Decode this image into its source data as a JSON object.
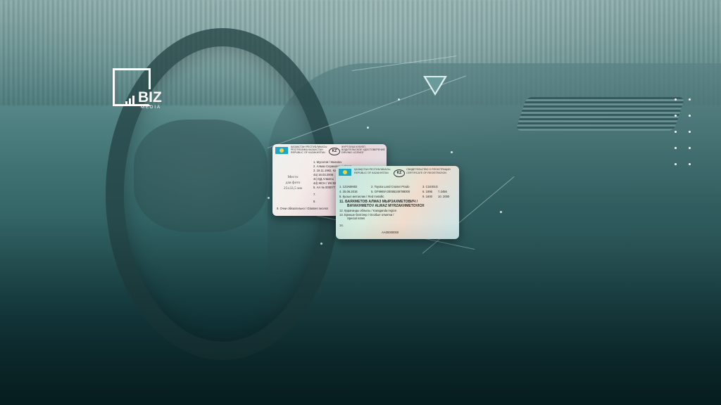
{
  "logo": {
    "brand": "BIZ",
    "media": "MEDIA"
  },
  "license_card": {
    "header_ru": "ҚАЗАҚСТАН РЕСПУБЛИКАСЫ",
    "header_ru2": "РЕСПУБЛИКА КАЗАХСТАН",
    "header_en": "REPUBLIC OF KAZAKHSTAN",
    "doc_kz": "ЖҮРГІЗУШІ КУӘЛІГІ",
    "doc_ru": "ВОДИТЕЛЬСКОЕ УДОСТОВЕРЕНИЕ",
    "doc_en": "DRIVING LICENCE",
    "kz_badge": "KZ",
    "photo_line1": "Место",
    "photo_line2": "для фото",
    "photo_line3": "25x33,5 мм",
    "field1": "1. Мусатов / Musatov",
    "field2": "2. Алмаз Серикович / Almaz",
    "field3": "3. 18.11.1982, Ка",
    "field4a": "4a) 16.03.2008",
    "field4c": "4c) ҚД Алматы",
    "field4d": "4d) ЖСН / ИН 82",
    "field5": "5. АА № 000077",
    "field7": "7.",
    "field8": "8.",
    "field9": "9. Очки обязательно / Glasses necess"
  },
  "registration_card": {
    "header_ru": "ҚАЗАҚСТАН РЕСПУБЛИКАСЫ",
    "header_en": "REPUBLIC OF KAZAKHSTAN",
    "doc_ru": "СВИДЕТЕЛЬСТВО О РЕГИСТРАЦИИ",
    "doc_en": "CERTIFICATE OF REGISTRATION",
    "kz_badge": "KZ",
    "f1": "1. 123ABM02",
    "f2": "2. Toyota Land Cruiser Prado",
    "f3": "3. С1EI01G",
    "f4": "4. 25.06.2016",
    "f5": "5. GF9965Y20065249788000",
    "f6": "6. 1995",
    "f6b": "7.3456",
    "f8": "8. Қызыл металлик / Red metallic",
    "f9": "9. 1600",
    "f9b": "10. 2000",
    "owner_ru": "11. БАЯХМЕТОВ АЛМАЗ МЫРЗАХМЕТОВИЧ /",
    "owner_en": "BAYAKHMETOV ALMAZ MYRZAKHMETOVICH",
    "f12": "12. Қарағанды облысы / Karaganda region",
    "f13": "13. Ерекше белгілер / Особые отметки /",
    "f13b": "Special notes",
    "f14": "14.",
    "serial": "AA00000000"
  },
  "colors": {
    "accent": "#5f8e8f",
    "dark": "#0a2527"
  }
}
